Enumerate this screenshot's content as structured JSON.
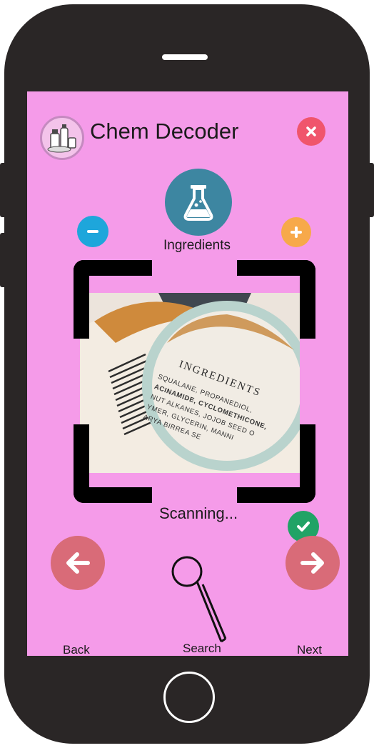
{
  "app": {
    "title": "Chem Decoder",
    "logo_icon": "cosmetics-bottles-icon"
  },
  "top_actions": {
    "close_icon": "close-icon",
    "close_color": "#f0556c"
  },
  "category": {
    "label": "Ingredients",
    "icon": "flask-icon",
    "icon_color": "#3d86a1"
  },
  "zoom": {
    "minus_icon": "minus-icon",
    "minus_color": "#1ea6db",
    "plus_icon": "plus-icon",
    "plus_color": "#f7a94a"
  },
  "scan": {
    "status": "Scanning...",
    "label_heading": "INGREDIENTS",
    "label_lines": [
      "SQUALANE, PROPANEDIOL,",
      "ACINAMIDE, CYCLOMETHICONE,",
      "NUT ALKANES, JOJOB SEED O",
      "YMER, GLYCERIN, MANNI",
      "ARYA BIRREA SE"
    ],
    "confirm_icon": "check-icon",
    "confirm_color": "#21a366"
  },
  "bottom_nav": {
    "back_label": "Back",
    "search_label": "Search",
    "next_label": "Next",
    "nav_color": "#d96b78"
  },
  "colors": {
    "screen_bg": "#f59be9",
    "phone_body": "#2a2626"
  }
}
